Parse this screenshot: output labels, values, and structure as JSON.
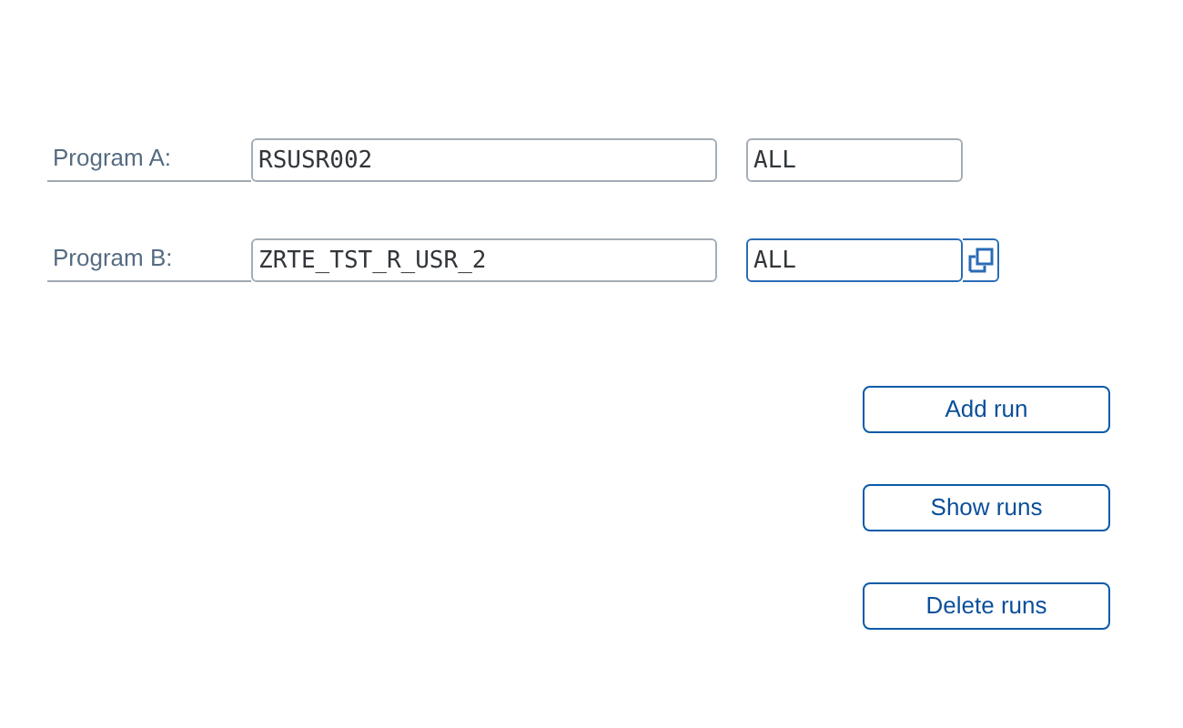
{
  "rows": [
    {
      "label": "Program A:",
      "program": "RSUSR002",
      "variant": "ALL",
      "focused": false
    },
    {
      "label": "Program B:",
      "program": "ZRTE_TST_R_USR_2",
      "variant": "ALL",
      "focused": true
    }
  ],
  "buttons": [
    "Add run",
    "Show runs",
    "Delete runs"
  ]
}
